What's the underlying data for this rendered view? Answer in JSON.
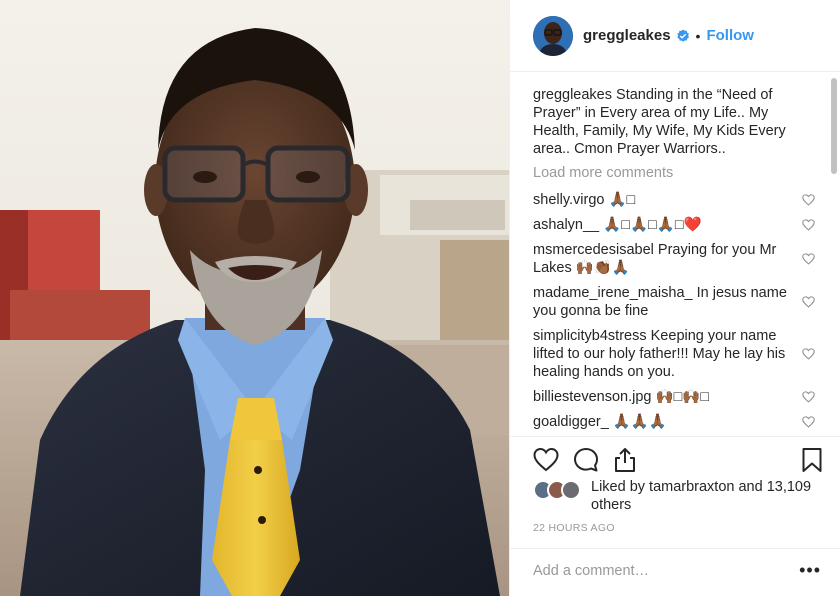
{
  "post": {
    "username": "greggleakes",
    "follow_label": "Follow",
    "dot": "•",
    "caption_user": "greggleakes",
    "caption_text": " Standing in the “Need of Prayer” in Every area of my Life.. My Health, Family, My Wife, My Kids Every area.. Cmon Prayer Warriors..",
    "load_more": "Load more comments",
    "comments": [
      {
        "user": "shelly.virgo",
        "text": " 🙏🏾□"
      },
      {
        "user": "ashalyn__",
        "text": " 🙏🏾□🙏🏾□🙏🏾□❤️"
      },
      {
        "user": "msmercedesisabel",
        "text": " Praying for you Mr Lakes 🙌🏾👏🏾🙏🏾"
      },
      {
        "user": "madame_irene_maisha_",
        "text": " In jesus name you gonna be fine"
      },
      {
        "user": "simplicityb4stress",
        "text": " Keeping your name lifted to our holy father!!! May he lay his healing hands on you."
      },
      {
        "user": "billiestevenson.jpg",
        "text": " 🙌🏾□🙌🏾□"
      },
      {
        "user": "goaldigger_",
        "text": " 🙏🏾🙏🏾🙏🏾"
      }
    ],
    "likes_text": "Liked by tamarbraxton and 13,109 others",
    "time": "22 HOURS AGO",
    "add_comment_placeholder": "Add a comment…",
    "more_label": "•••",
    "icons": {
      "like": "heart-icon",
      "comment": "comment-icon",
      "share": "share-icon",
      "save": "bookmark-icon",
      "verified": "verified-badge-icon"
    },
    "colors": {
      "link": "#3897f0",
      "muted": "#999999",
      "text": "#262626",
      "border": "#efefef"
    }
  }
}
